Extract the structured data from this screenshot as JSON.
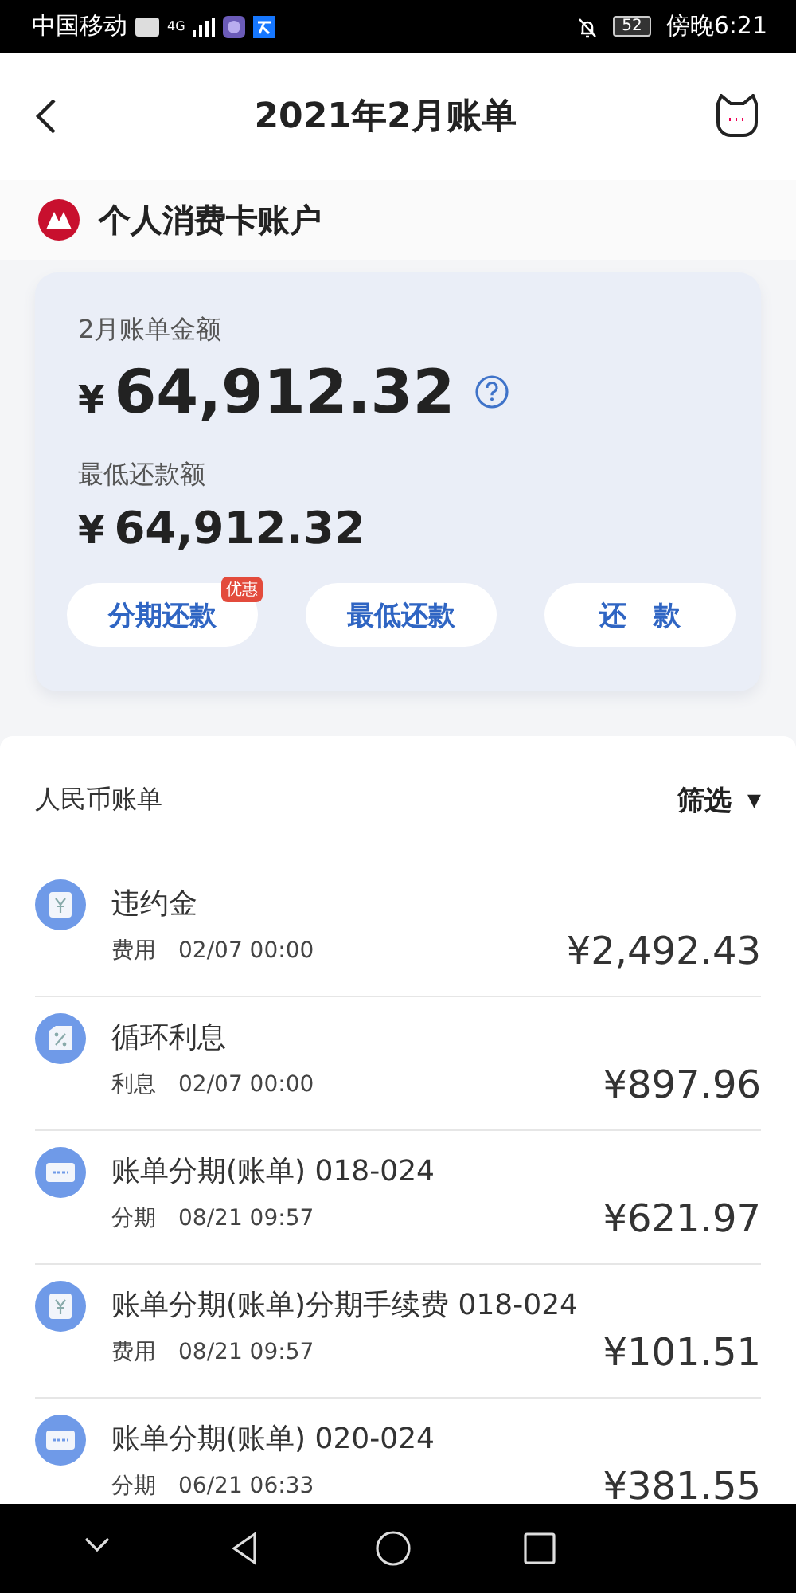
{
  "status_bar": {
    "carrier": "中国移动",
    "network": "4G",
    "battery": "52",
    "time": "傍晚6:21"
  },
  "header": {
    "title": "2021年2月账单"
  },
  "account": {
    "name": "个人消费卡账户"
  },
  "bill_card": {
    "amount_label": "2月账单金额",
    "currency": "¥",
    "amount": "64,912.32",
    "min_label": "最低还款额",
    "min_amount": "64,912.32",
    "buttons": [
      {
        "label": "分期还款",
        "badge": "优惠"
      },
      {
        "label": "最低还款"
      },
      {
        "label": "还　款"
      }
    ]
  },
  "list": {
    "title": "人民币账单",
    "filter": "筛选",
    "filter_icon": "▼",
    "rows": [
      {
        "kind": "yen",
        "title": "违约金",
        "type": "费用",
        "time": "02/07 00:00",
        "amount": "¥2,492.43"
      },
      {
        "kind": "percent",
        "title": "循环利息",
        "type": "利息",
        "time": "02/07 00:00",
        "amount": "¥897.96"
      },
      {
        "kind": "installment",
        "title": "账单分期(账单) 018-024",
        "type": "分期",
        "time": "08/21 09:57",
        "amount": "¥621.97"
      },
      {
        "kind": "yen",
        "title": "账单分期(账单)分期手续费 018-024",
        "type": "费用",
        "time": "08/21 09:57",
        "amount": "¥101.51"
      },
      {
        "kind": "installment",
        "title": "账单分期(账单) 020-024",
        "type": "分期",
        "time": "06/21 06:33",
        "amount": "¥381.55"
      }
    ]
  }
}
